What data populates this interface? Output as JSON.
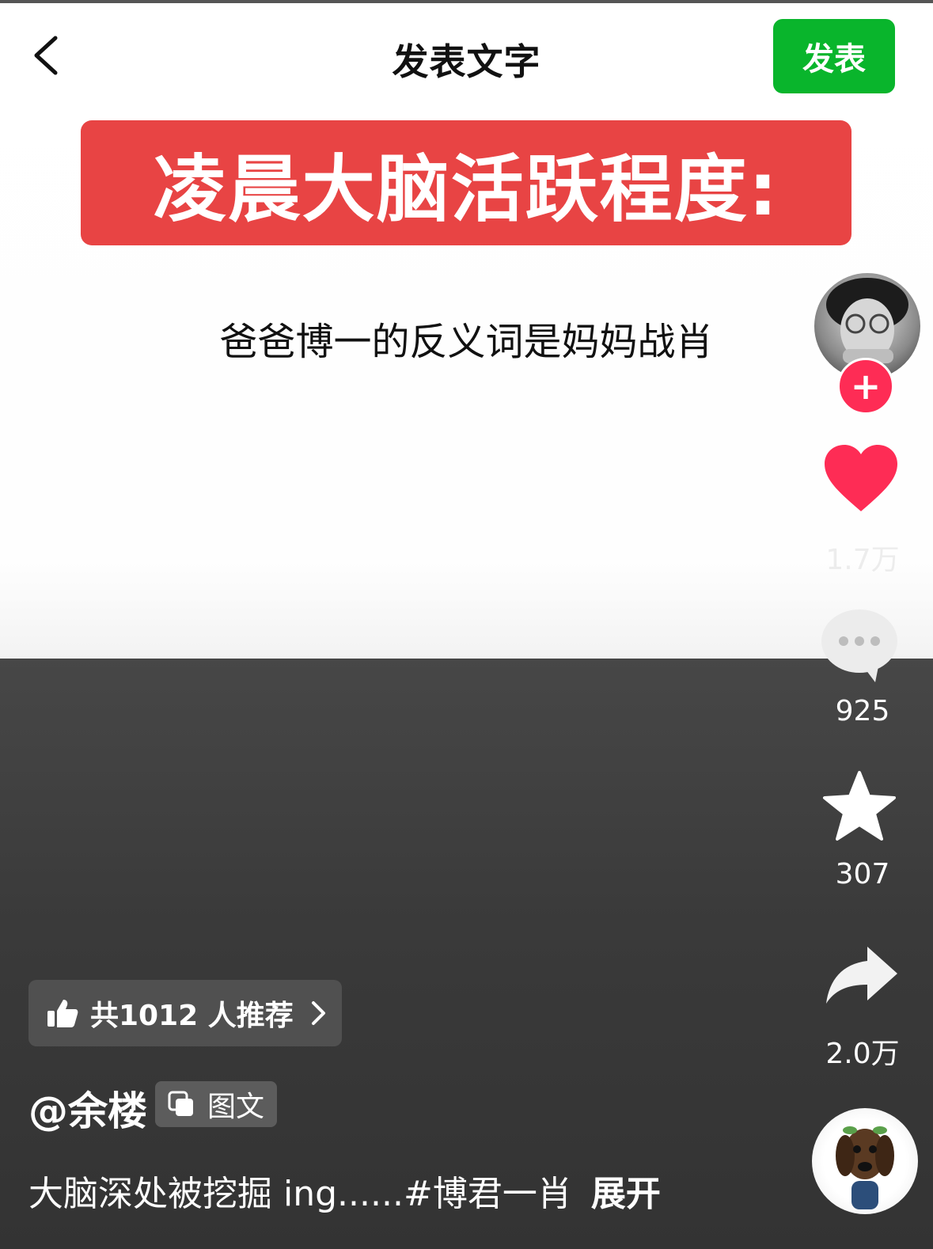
{
  "header": {
    "title": "发表文字",
    "publish_label": "发表"
  },
  "post": {
    "banner_text": "凌晨大脑活跃程度:",
    "body_text": "爸爸博一的反义词是妈妈战肖"
  },
  "actions": {
    "like_count": "1.7万",
    "comment_count": "925",
    "favorite_count": "307",
    "share_count": "2.0万"
  },
  "recommend": {
    "label": "共1012 人推荐"
  },
  "author": {
    "name": "@余楼",
    "type_tag": "图文"
  },
  "caption": {
    "text": "大脑深处被挖掘 ing......",
    "hashtag": "#博君一肖",
    "expand": "展开"
  },
  "colors": {
    "publish_green": "#09b52c",
    "banner_red": "#e84444",
    "like_red": "#fe2c55"
  }
}
